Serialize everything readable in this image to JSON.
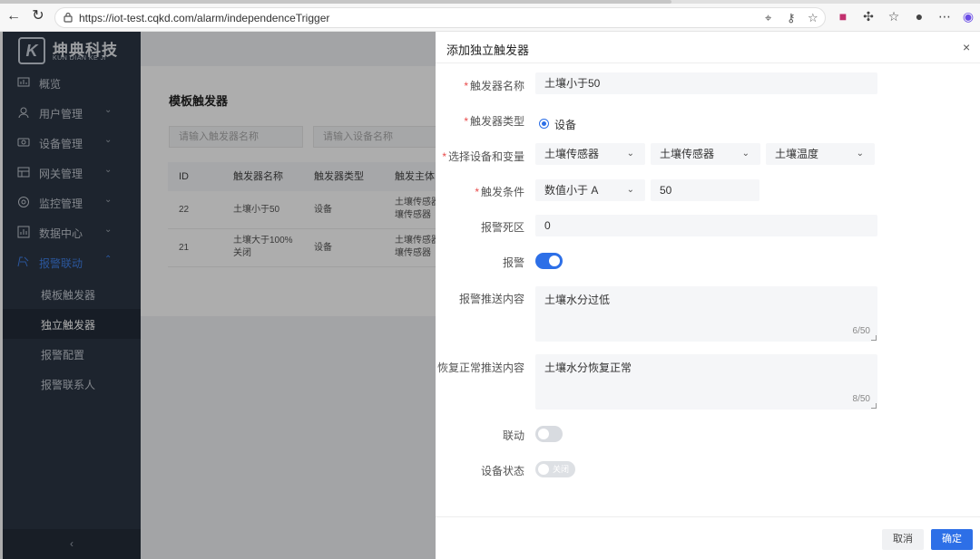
{
  "browser": {
    "url": "https://iot-test.cqkd.com/alarm/independenceTrigger"
  },
  "brand": {
    "name_cn": "坤典科技",
    "name_en": "KUN DIAN KE JI"
  },
  "sidebar": {
    "items": [
      {
        "label": "概览",
        "icon": "dashboard-icon"
      },
      {
        "label": "用户管理",
        "icon": "user-icon"
      },
      {
        "label": "设备管理",
        "icon": "device-icon"
      },
      {
        "label": "网关管理",
        "icon": "gateway-icon"
      },
      {
        "label": "监控管理",
        "icon": "monitor-icon"
      },
      {
        "label": "数据中心",
        "icon": "data-icon"
      },
      {
        "label": "报警联动",
        "icon": "alarm-icon"
      }
    ],
    "subitems": [
      {
        "label": "模板触发器"
      },
      {
        "label": "独立触发器"
      },
      {
        "label": "报警配置"
      },
      {
        "label": "报警联系人"
      }
    ],
    "collapse_glyph": "‹"
  },
  "page": {
    "title": "模板触发器",
    "filters": {
      "trigger_name_placeholder": "请输入触发器名称",
      "device_name_placeholder": "请输入设备名称"
    },
    "table": {
      "headers": [
        "ID",
        "触发器名称",
        "触发器类型",
        "触发主体"
      ],
      "rows": [
        {
          "id": "22",
          "name": "土壤小于50",
          "type": "设备",
          "subject": "土壤传感器\n壤传感器"
        },
        {
          "id": "21",
          "name": "土壤大于100%\n关闭",
          "type": "设备",
          "subject": "土壤传感器\n壤传感器"
        }
      ]
    }
  },
  "drawer": {
    "title": "添加独立触发器",
    "close_glyph": "×",
    "fields": {
      "name": {
        "label": "触发器名称",
        "value": "土壤小于50"
      },
      "type": {
        "label": "触发器类型",
        "option": "设备"
      },
      "device_var": {
        "label": "选择设备和变量",
        "select1": "土壤传感器",
        "select2": "土壤传感器",
        "select3": "土壤温度"
      },
      "condition": {
        "label": "触发条件",
        "operator": "数值小于 A",
        "value": "50"
      },
      "deadband": {
        "label": "报警死区",
        "value": "0"
      },
      "alarm": {
        "label": "报警",
        "on": true
      },
      "alarm_content": {
        "label": "报警推送内容",
        "value": "土壤水分过低",
        "count": "6/50"
      },
      "recover_content": {
        "label": "恢复正常推送内容",
        "value": "土壤水分恢复正常",
        "count": "8/50"
      },
      "linkage": {
        "label": "联动",
        "on": false
      },
      "device_status": {
        "label": "设备状态",
        "switch_text": "关闭"
      }
    },
    "buttons": {
      "cancel": "取消",
      "ok": "确定"
    }
  },
  "colors": {
    "primary": "#2d6fe7",
    "sidebar_bg": "#2c3644",
    "required": "#e84a4a"
  }
}
